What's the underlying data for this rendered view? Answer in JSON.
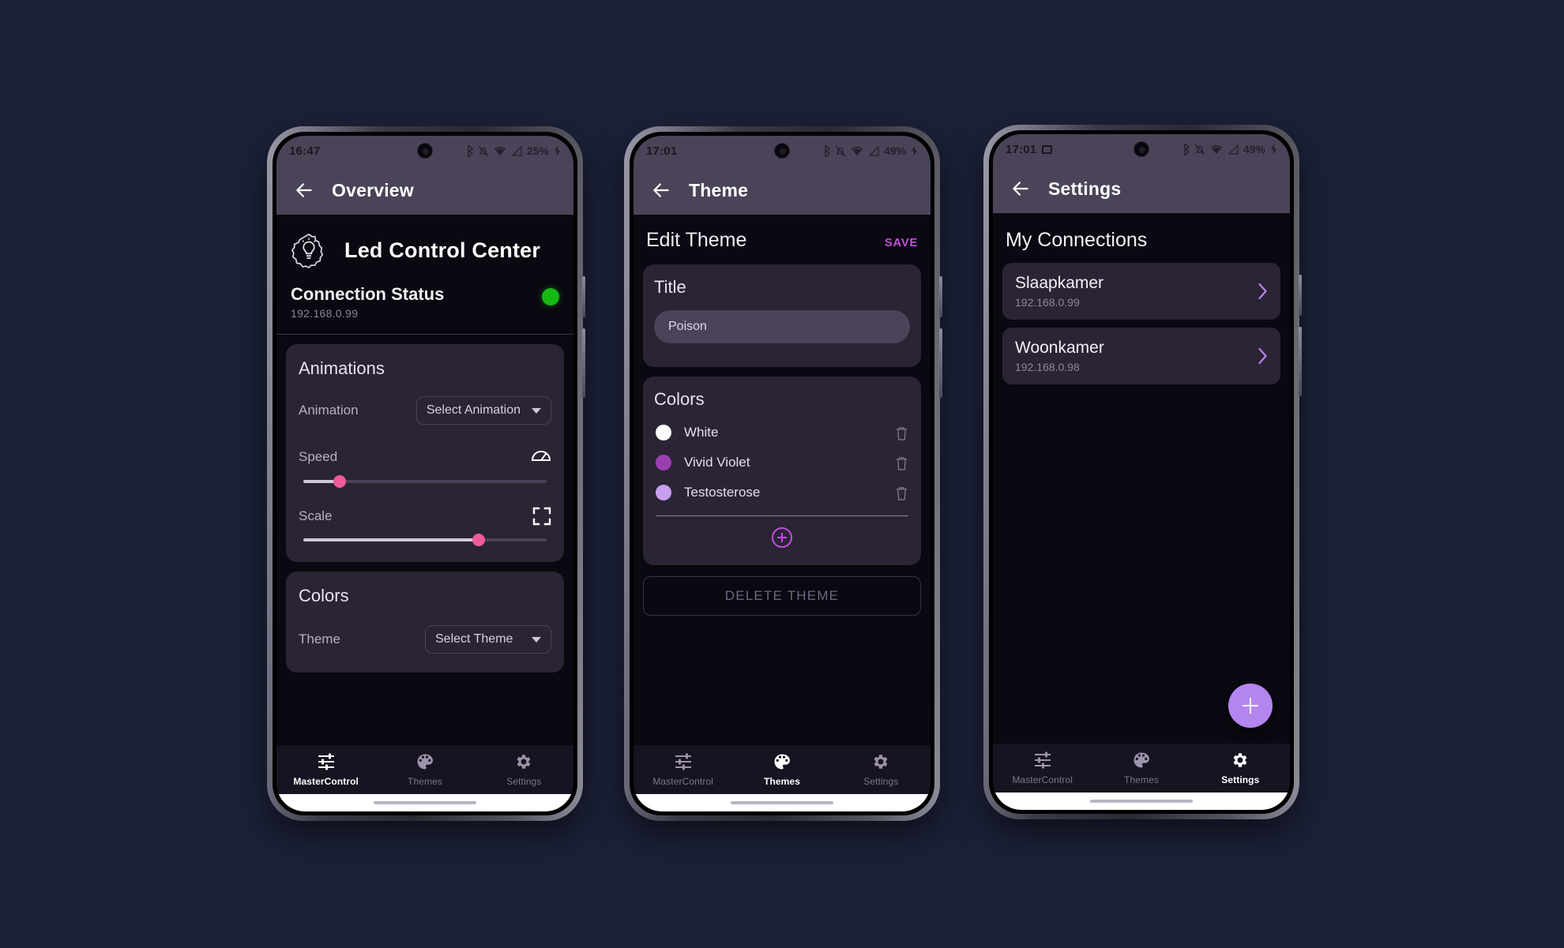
{
  "phones": [
    {
      "id": "overview",
      "status": {
        "time": "16:47",
        "battery": "25%",
        "icons": [
          "bluetooth-icon",
          "bell-off-icon",
          "wifi-icon",
          "signal-icon",
          "charging-bolt-icon"
        ],
        "has_mini_icon": false
      },
      "appbar": {
        "title": "Overview",
        "back_icon": "back-arrow-icon"
      },
      "hero": {
        "logo_icon": "gear-bulb-logo-icon",
        "brand": "Led Control Center"
      },
      "connection": {
        "title": "Connection Status",
        "ip": "192.168.0.99",
        "status_color": "#16b814"
      },
      "animations": {
        "title": "Animations",
        "animation_label": "Animation",
        "animation_value": "Select Animation",
        "speed_label": "Speed",
        "speed_icon": "speedometer-icon",
        "speed_percent": 15,
        "scale_label": "Scale",
        "scale_icon": "fullscreen-icon",
        "scale_percent": 72
      },
      "colors": {
        "title": "Colors",
        "theme_label": "Theme",
        "theme_value": "Select Theme"
      },
      "nav": {
        "active": "MasterControl"
      }
    },
    {
      "id": "theme",
      "status": {
        "time": "17:01",
        "battery": "49%",
        "icons": [
          "bluetooth-icon",
          "bell-off-icon",
          "wifi-icon",
          "signal-icon",
          "charging-bolt-icon"
        ],
        "has_mini_icon": false
      },
      "appbar": {
        "title": "Theme",
        "back_icon": "back-arrow-icon"
      },
      "pagehead": {
        "title": "Edit Theme",
        "save": "SAVE",
        "save_color": "#c44ce0"
      },
      "title_card": {
        "label": "Title",
        "value": "Poison"
      },
      "colors_card": {
        "title": "Colors",
        "items": [
          {
            "name": "White",
            "hex": "#ffffff"
          },
          {
            "name": "Vivid Violet",
            "hex": "#9b3fb0"
          },
          {
            "name": "Testosterose",
            "hex": "#c89ef0"
          }
        ],
        "add_icon": "add-circle-icon",
        "delete_row_icon": "trash-icon"
      },
      "delete_button": "DELETE THEME",
      "nav": {
        "active": "Themes"
      }
    },
    {
      "id": "settings",
      "status": {
        "time": "17:01",
        "battery": "49%",
        "icons": [
          "bluetooth-icon",
          "bell-off-icon",
          "wifi-icon",
          "signal-icon",
          "charging-bolt-icon"
        ],
        "has_mini_icon": true
      },
      "appbar": {
        "title": "Settings",
        "back_icon": "back-arrow-icon"
      },
      "page_title": "My Connections",
      "connections": [
        {
          "name": "Slaapkamer",
          "ip": "192.168.0.99"
        },
        {
          "name": "Woonkamer",
          "ip": "192.168.0.98"
        }
      ],
      "fab": {
        "icon": "plus-icon",
        "color": "#b585ef"
      },
      "nav": {
        "active": "Settings"
      }
    }
  ],
  "nav_labels": {
    "master": "MasterControl",
    "themes": "Themes",
    "settings": "Settings"
  },
  "nav_icons": {
    "master": "sliders-icon",
    "themes": "palette-icon",
    "settings": "gear-icon"
  },
  "theme_colors": {
    "card": "#2a2435",
    "background": "#0a0810",
    "appbar": "#4b4458",
    "accent": "#c44ce0",
    "slider_thumb": "#ef5a9a"
  }
}
